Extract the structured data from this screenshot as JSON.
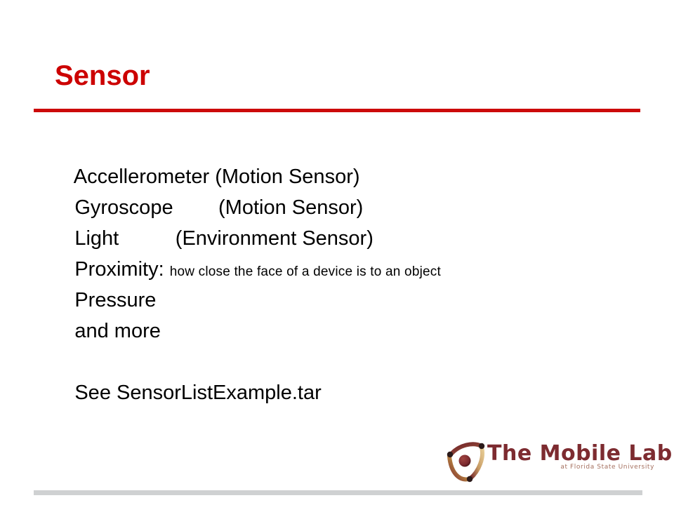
{
  "slide": {
    "title": "Sensor",
    "title_color": "#cc0000",
    "rule_color": "#cc0a0a",
    "footer_rule_color": "#cfd1d2",
    "background": "#ffffff",
    "body_lines": [
      {
        "text": "Accellerometer (Motion Sensor)",
        "note": ""
      },
      {
        "text": "Gyroscope        (Motion Sensor)",
        "note": ""
      },
      {
        "text": "Light          (Environment Sensor)",
        "note": ""
      },
      {
        "text": "Proximity: ",
        "note": "how close the face of a device is to an object"
      },
      {
        "text": "Pressure",
        "note": ""
      },
      {
        "text": "and more",
        "note": ""
      },
      {
        "text": "",
        "note": ""
      },
      {
        "text": "See SensorListExample.tar",
        "note": ""
      }
    ]
  },
  "logo": {
    "name": "The Mobile Lab",
    "tagline": "at Florida State University",
    "word_color": "#7d2b30",
    "tagline_color": "#a5705f",
    "mark_colors": {
      "arm_dark": "#7d2b30",
      "arm_light": "#e0c083",
      "center_sphere": "#7d2b30",
      "tip_dot": "#2b1a1a"
    }
  }
}
